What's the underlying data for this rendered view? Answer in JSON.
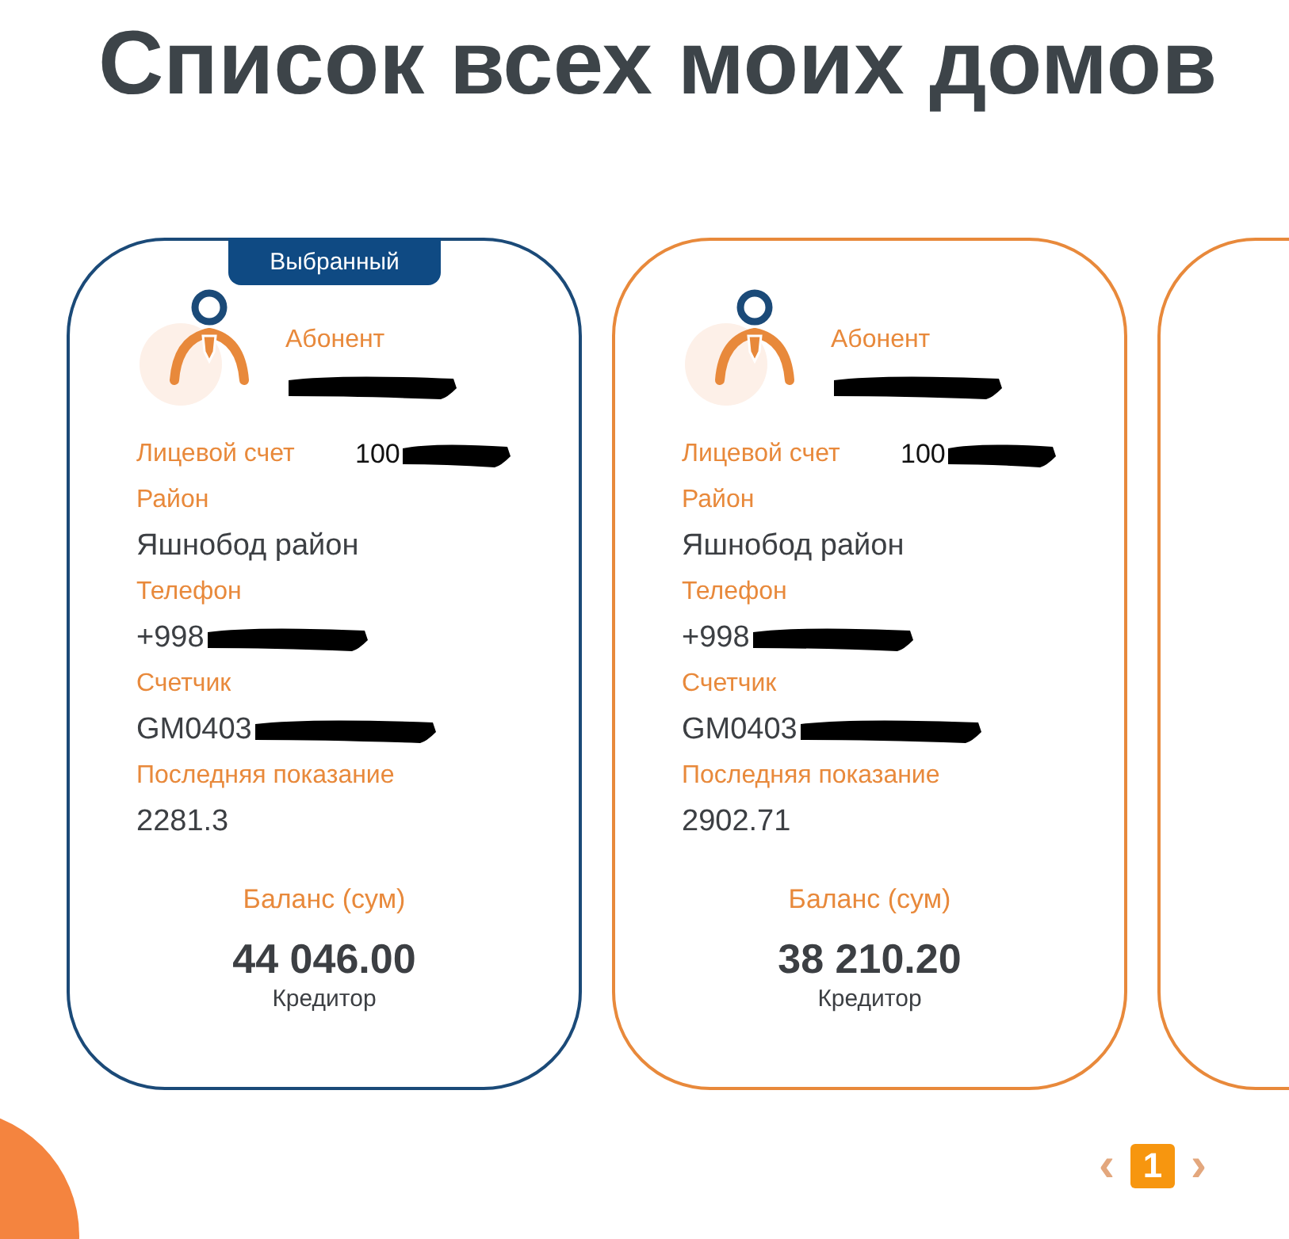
{
  "title": "Список всех моих домов",
  "cards": [
    {
      "kind": "full",
      "selected": true,
      "badge": "Выбранный",
      "subscriber_label": "Абонент",
      "subscriber_redacted": true,
      "account_label": "Лицевой счет",
      "account_value": "100",
      "account_redacted": true,
      "fields": [
        {
          "label": "Район",
          "value": "Яшнобод район",
          "redacted": false
        },
        {
          "label": "Телефон",
          "value": "+998",
          "redacted": true
        },
        {
          "label": "Счетчик",
          "value": "GM0403",
          "redacted": true
        },
        {
          "label": "Последняя показание",
          "value": "2281.3",
          "redacted": false
        }
      ],
      "balance_label": "Баланс (сум)",
      "balance": "44 046.00",
      "balance_status": "Кредитор"
    },
    {
      "kind": "full",
      "selected": false,
      "subscriber_label": "Абонент",
      "subscriber_redacted": true,
      "account_label": "Лицевой счет",
      "account_value": "100",
      "account_redacted": true,
      "fields": [
        {
          "label": "Район",
          "value": "Яшнобод район",
          "redacted": false
        },
        {
          "label": "Телефон",
          "value": "+998",
          "redacted": true
        },
        {
          "label": "Счетчик",
          "value": "GM0403",
          "redacted": true
        },
        {
          "label": "Последняя показание",
          "value": "2902.71",
          "redacted": false
        }
      ],
      "balance_label": "Баланс (сум)",
      "balance": "38 210.20",
      "balance_status": "Кредитор"
    },
    {
      "kind": "edge",
      "selected": false
    }
  ],
  "pagination": {
    "prev": "‹",
    "pages": [
      {
        "label": "1",
        "selected": true
      }
    ],
    "next": "›"
  }
}
